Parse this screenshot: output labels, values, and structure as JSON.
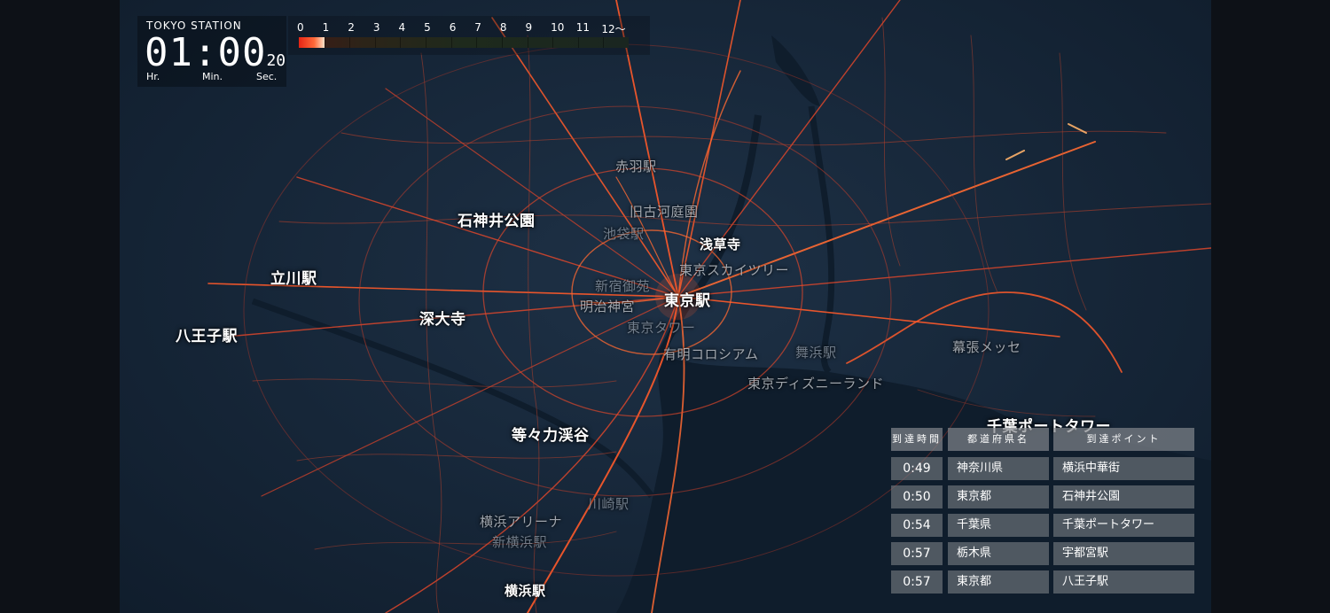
{
  "clock": {
    "station": "TOKYO STATION",
    "time_main": "01:00",
    "time_seconds": "20",
    "unit_hr": "Hr.",
    "unit_min": "Min.",
    "unit_sec": "Sec."
  },
  "legend": {
    "ticks": [
      "0",
      "1",
      "2",
      "3",
      "4",
      "5",
      "6",
      "7",
      "8",
      "9",
      "10",
      "11",
      "12〜"
    ],
    "current_level": 1
  },
  "map_labels": {
    "akabane": "赤羽駅",
    "shakujii": "石神井公園",
    "kyufurukawa": "旧古河庭園",
    "ikebukuro": "池袋駅",
    "asakusa": "浅草寺",
    "skytree": "東京スカイツリー",
    "tachikawa": "立川駅",
    "shinjuku_gyoen": "新宿御苑",
    "tokyo_station": "東京駅",
    "meiji_jingu": "明治神宮",
    "jindaiji": "深大寺",
    "hachioji": "八王子駅",
    "tokyo_tower": "東京タワー",
    "ariake": "有明コロシアム",
    "maihama": "舞浜駅",
    "makuhari": "幕張メッセ",
    "disneyland": "東京ディズニーランド",
    "chiba_port_tower": "千葉ポートタワー",
    "todoroki": "等々力渓谷",
    "kawasaki": "川崎駅",
    "yokohama_arena": "横浜アリーナ",
    "shin_yokohama": "新横浜駅",
    "yokohama": "横浜駅"
  },
  "arrivals": {
    "headers": [
      "到達時間",
      "都道府県名",
      "到達ポイント"
    ],
    "rows": [
      {
        "time": "0:49",
        "prefecture": "神奈川県",
        "point": "横浜中華街"
      },
      {
        "time": "0:50",
        "prefecture": "東京都",
        "point": "石神井公園"
      },
      {
        "time": "0:54",
        "prefecture": "千葉県",
        "point": "千葉ポートタワー"
      },
      {
        "time": "0:57",
        "prefecture": "栃木県",
        "point": "宇都宮駅"
      },
      {
        "time": "0:57",
        "prefecture": "東京都",
        "point": "八王子駅"
      }
    ]
  },
  "colors": {
    "road_bright": "#ff5a2a",
    "road_dim": "#c8442a",
    "land": "#1a2b3e",
    "bay": "#0e1a28"
  }
}
